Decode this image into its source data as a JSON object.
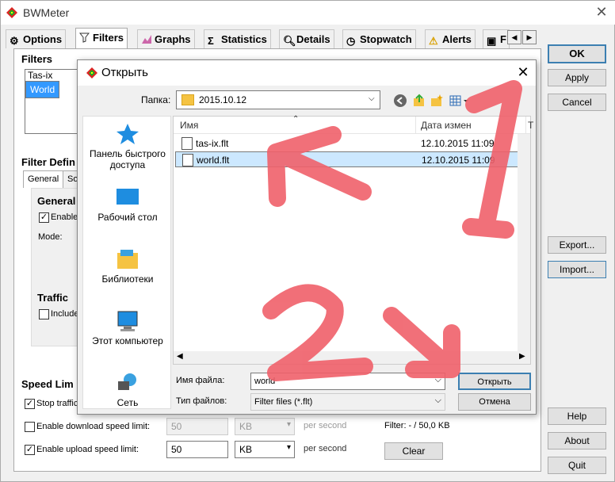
{
  "app": {
    "title": "BWMeter"
  },
  "tabs": [
    {
      "label": "Options",
      "icon": "gear-icon"
    },
    {
      "label": "Filters",
      "icon": "funnel-icon"
    },
    {
      "label": "Graphs",
      "icon": "graph-icon"
    },
    {
      "label": "Statistics",
      "icon": "sigma-icon"
    },
    {
      "label": "Details",
      "icon": "magnifier-icon"
    },
    {
      "label": "Stopwatch",
      "icon": "stopwatch-icon"
    },
    {
      "label": "Alerts",
      "icon": "warning-icon"
    },
    {
      "label": "F",
      "icon": "network-icon"
    }
  ],
  "right_buttons": {
    "ok": "OK",
    "apply": "Apply",
    "cancel": "Cancel",
    "export": "Export...",
    "import": "Import...",
    "help": "Help",
    "about": "About",
    "quit": "Quit"
  },
  "filters": {
    "group_label": "Filters",
    "items": [
      "Tas-ix",
      "World"
    ],
    "selected": "World"
  },
  "filter_def": {
    "group_label": "Filter Defin",
    "tab_general": "General",
    "tab_other": "So",
    "general_label": "General",
    "enabled_label": "Enabled",
    "enabled": true,
    "mode_label": "Mode:",
    "traffic_label": "Traffic",
    "include_label": "Include"
  },
  "speed": {
    "group_label": "Speed Lim",
    "stop_label": "Stop traffic",
    "stop_checked": true,
    "download_label": "Enable download speed limit:",
    "download_checked": false,
    "download_value": "50",
    "download_unit": "KB",
    "upload_label": "Enable upload speed limit:",
    "upload_checked": true,
    "upload_value": "50",
    "upload_unit": "KB",
    "per_second": "per second",
    "filter_status": "Filter: - / 50,0 KB",
    "clear_label": "Clear"
  },
  "dialog": {
    "title": "Открыть",
    "folder_label": "Папка:",
    "folder_value": "2015.10.12",
    "places": [
      "Панель быстрого доступа",
      "Рабочий стол",
      "Библиотеки",
      "Этот компьютер",
      "Сеть"
    ],
    "col_name": "Имя",
    "col_date": "Дата измен",
    "col_extra": "Т",
    "files": [
      {
        "name": "tas-ix.flt",
        "date": "12.10.2015 11:09",
        "extra": "А"
      },
      {
        "name": "world.flt",
        "date": "12.10.2015 11:09",
        "extra": "А"
      }
    ],
    "selected_file": "world.flt",
    "filename_label": "Имя файла:",
    "filename_value": "world",
    "filetype_label": "Тип файлов:",
    "filetype_value": "Filter files (*.flt)",
    "open_button": "Открыть",
    "cancel_button": "Отмена"
  },
  "annotations": {
    "step1": "1",
    "step2": "2",
    "color": "#f0606a"
  }
}
